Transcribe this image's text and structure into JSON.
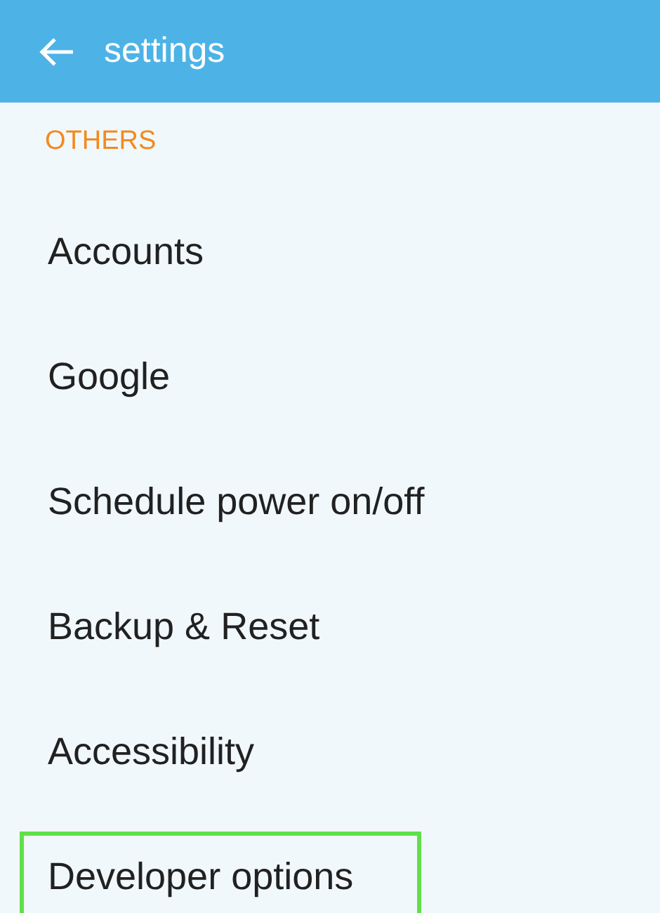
{
  "header": {
    "title": "settings"
  },
  "section": {
    "title": "OTHERS"
  },
  "items": [
    {
      "label": "Accounts",
      "highlighted": false
    },
    {
      "label": "Google",
      "highlighted": false
    },
    {
      "label": "Schedule power on/off",
      "highlighted": false
    },
    {
      "label": "Backup & Reset",
      "highlighted": false
    },
    {
      "label": "Accessibility",
      "highlighted": false
    },
    {
      "label": "Developer options",
      "highlighted": true
    }
  ]
}
